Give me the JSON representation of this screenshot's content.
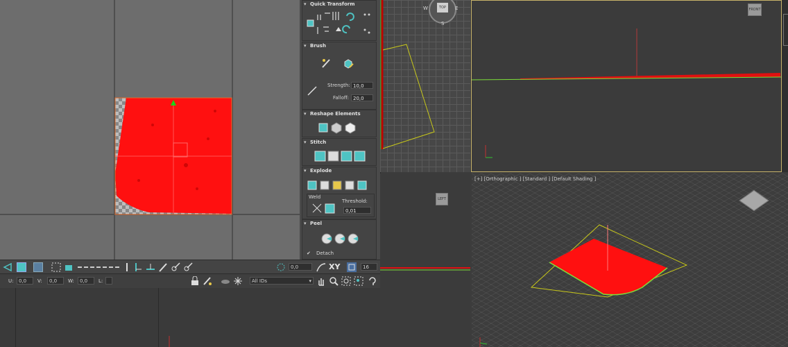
{
  "uv_editor": {},
  "panel": {
    "quick_transform": {
      "title": "Quick Transform"
    },
    "brush": {
      "title": "Brush",
      "strength_label": "Strength:",
      "strength_value": "10,0",
      "falloff_label": "Falloff:",
      "falloff_value": "20,0"
    },
    "reshape": {
      "title": "Reshape Elements"
    },
    "stitch": {
      "title": "Stitch"
    },
    "explode": {
      "title": "Explode",
      "weld_label": "Weld",
      "threshold_label": "Threshold:",
      "threshold_value": "0,01"
    },
    "peel": {
      "title": "Peel",
      "detach_label": "Detach"
    }
  },
  "viewports": {
    "top_left_nav": {
      "w": "W",
      "e": "E",
      "s": "S",
      "cube": "TOP"
    },
    "top_right_cube": "FRONT",
    "bottom_left_cube": "LEFT",
    "perspective_label": "[+] [Orthographic ] [Standard ] [Default Shading ]"
  },
  "uv_toolbar": {
    "angle_value": "0,0",
    "xy_label": "XY",
    "snap_value": "16"
  },
  "uv_status": {
    "u_label": "U:",
    "u_value": "0,0",
    "v_label": "V:",
    "v_value": "0,0",
    "w_label": "W:",
    "w_value": "0,0",
    "l_label": "L:",
    "ids_value": "All IDs"
  },
  "colors": {
    "uv_fill": "#ff0000",
    "accent": "#4ec3c3",
    "viewport_active_border": "#c8b46a"
  }
}
